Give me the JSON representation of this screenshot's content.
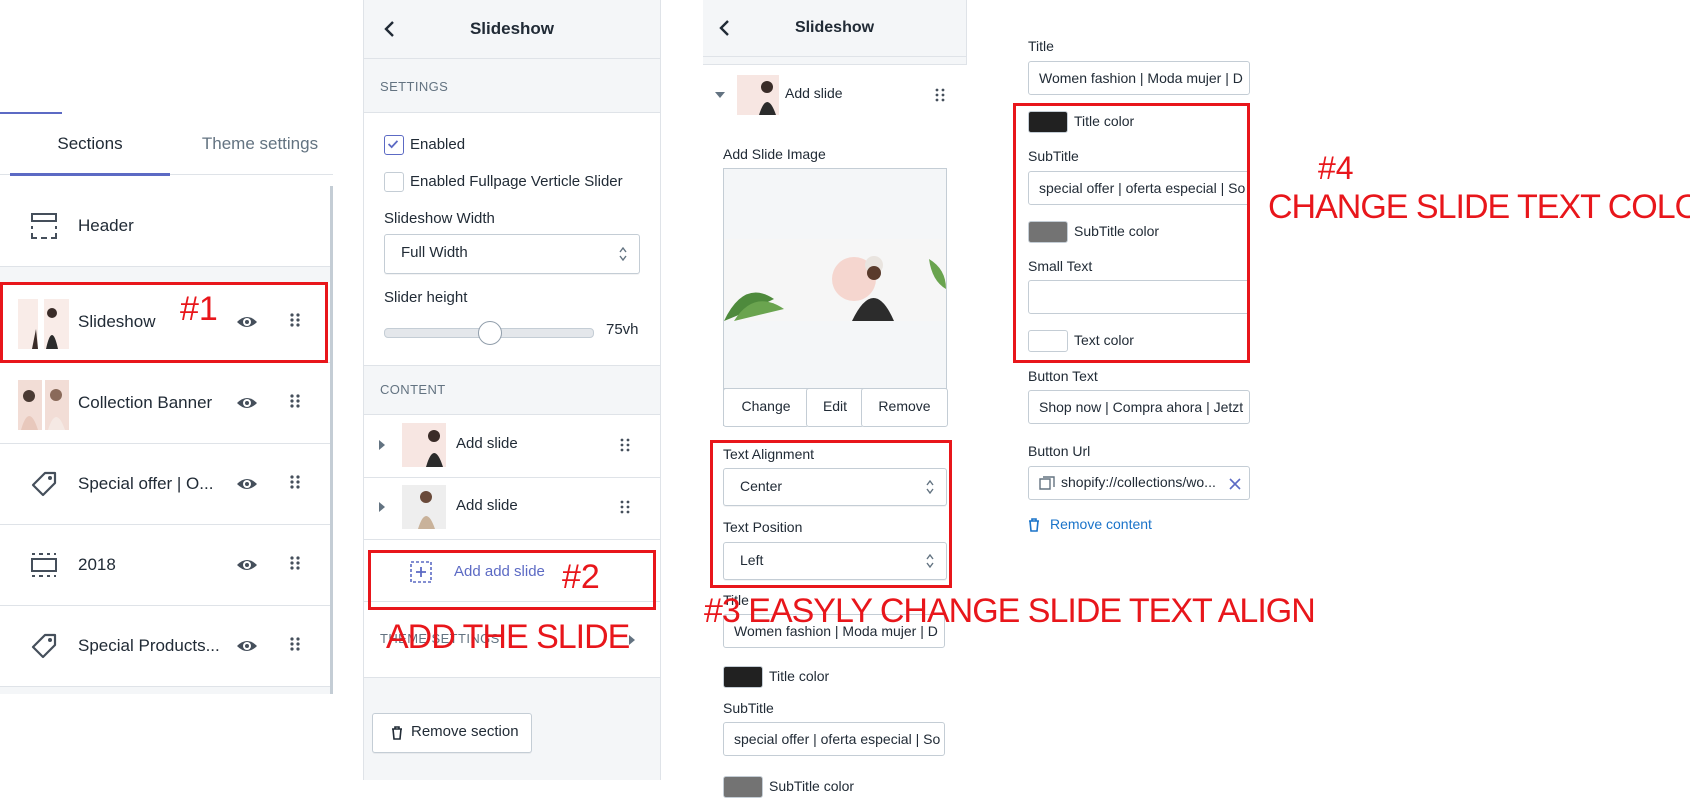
{
  "panel_sections": {
    "tabs": [
      "Sections",
      "Theme settings"
    ],
    "rows": [
      {
        "label": "Header",
        "icon": "header-layout-icon"
      },
      {
        "label": "Slideshow",
        "icon": "slide-thumbnail"
      },
      {
        "label": "Collection Banner",
        "icon": "collection-thumbnail"
      },
      {
        "label": "Special offer | O...",
        "icon": "tag-icon"
      },
      {
        "label": "2018",
        "icon": "gallery-layout-icon"
      },
      {
        "label": "Special Products...",
        "icon": "tag-icon"
      }
    ]
  },
  "panel_slideshow": {
    "title": "Slideshow",
    "settings_heading": "SETTINGS",
    "enabled_label": "Enabled",
    "enabled_checked": true,
    "fullpage_label": "Enabled Fullpage Verticle Slider",
    "fullpage_checked": false,
    "width_label": "Slideshow Width",
    "width_value": "Full Width",
    "height_label": "Slider height",
    "height_value": "75vh",
    "height_level": 0.5,
    "content_heading": "CONTENT",
    "slides": [
      "Add slide",
      "Add slide"
    ],
    "add_slide_label": "Add add slide",
    "theme_settings_label": "THEME SETTINGS",
    "remove_section_label": "Remove section"
  },
  "panel_slide": {
    "title": "Slideshow",
    "slide_label": "Add slide",
    "image_label": "Add Slide Image",
    "image_buttons": [
      "Change",
      "Edit",
      "Remove"
    ],
    "align_label": "Text Alignment",
    "align_value": "Center",
    "position_label": "Text Position",
    "position_value": "Left",
    "title_label": "Title",
    "title_value": "Women fashion | Moda mujer | D",
    "title_color_label": "Title color",
    "subtitle_label": "SubTitle",
    "subtitle_value": "special offer | oferta especial | So",
    "subtitle_color_label": "SubTitle color"
  },
  "panel_slide_more": {
    "title_label": "Title",
    "title_value": "Women fashion | Moda mujer | D",
    "title_color_label": "Title color",
    "subtitle_label": "SubTitle",
    "subtitle_value": "special offer | oferta especial | So",
    "subtitle_color_label": "SubTitle color",
    "small_text_label": "Small Text",
    "small_text_value": "",
    "text_color_label": "Text color",
    "button_text_label": "Button Text",
    "button_text_value": "Shop now | Compra ahora | Jetzt",
    "button_url_label": "Button Url",
    "button_url_value": "shopify://collections/wo...",
    "remove_content_label": "Remove content"
  },
  "colors": {
    "title_color": "#212121",
    "subtitle_color": "#737373",
    "text_color": "#ffffff",
    "accent": "#5c6ac4",
    "annotation": "#e8161b"
  },
  "annotations": {
    "a1": "#1",
    "a2": "#2",
    "a2_caption": "ADD THE SLIDE",
    "a3": "#3 EASYLY CHANGE SLIDE TEXT ALIGN",
    "a4": "#4",
    "a4_caption": "CHANGE SLIDE TEXT COLOR"
  }
}
